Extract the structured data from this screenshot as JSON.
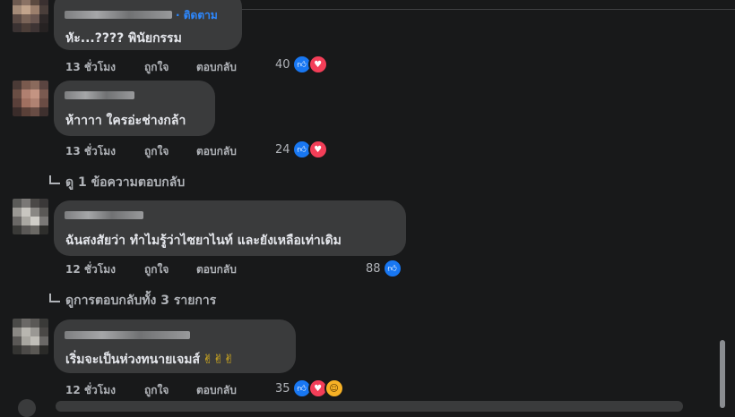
{
  "colors": {
    "background": "#18191a",
    "bubble": "#3a3b3c",
    "text": "#e4e6eb",
    "meta": "#b0b3b8",
    "link": "#2d88ff",
    "like": "#1877f2",
    "love": "#f33e58"
  },
  "comments": [
    {
      "follow_label": "· ติดตาม",
      "text": "หัะ...???? พินัยกรรม",
      "time": "13 ชั่วโมง",
      "like_label": "ถูกใจ",
      "reply_label": "ตอบกลับ",
      "reaction_count": "40",
      "reactions": [
        "like-icon",
        "love-icon"
      ]
    },
    {
      "text": "ห้าาาา ใครอ่ะช่างกล้า",
      "time": "13 ชั่วโมง",
      "like_label": "ถูกใจ",
      "reply_label": "ตอบกลับ",
      "reaction_count": "24",
      "reactions": [
        "like-icon",
        "love-icon"
      ],
      "view_replies": "ดู 1 ข้อความตอบกลับ"
    },
    {
      "text": "ฉันสงสัยว่า ทำไมรู้ว่าไซยาไนท์ และยังเหลือเท่าเดิม",
      "time": "12 ชั่วโมง",
      "like_label": "ถูกใจ",
      "reply_label": "ตอบกลับ",
      "reaction_count": "88",
      "reactions": [
        "like-icon"
      ],
      "view_replies": "ดูการตอบกลับทั้ง 3 รายการ"
    },
    {
      "text": "เริ่มจะเป็นห่วงทนายเจมส์",
      "emoji": "✌✌✌",
      "time": "12 ชั่วโมง",
      "like_label": "ถูกใจ",
      "reply_label": "ตอบกลับ",
      "reaction_count": "35",
      "reactions": [
        "like-icon",
        "love-icon",
        "haha-icon"
      ]
    }
  ]
}
